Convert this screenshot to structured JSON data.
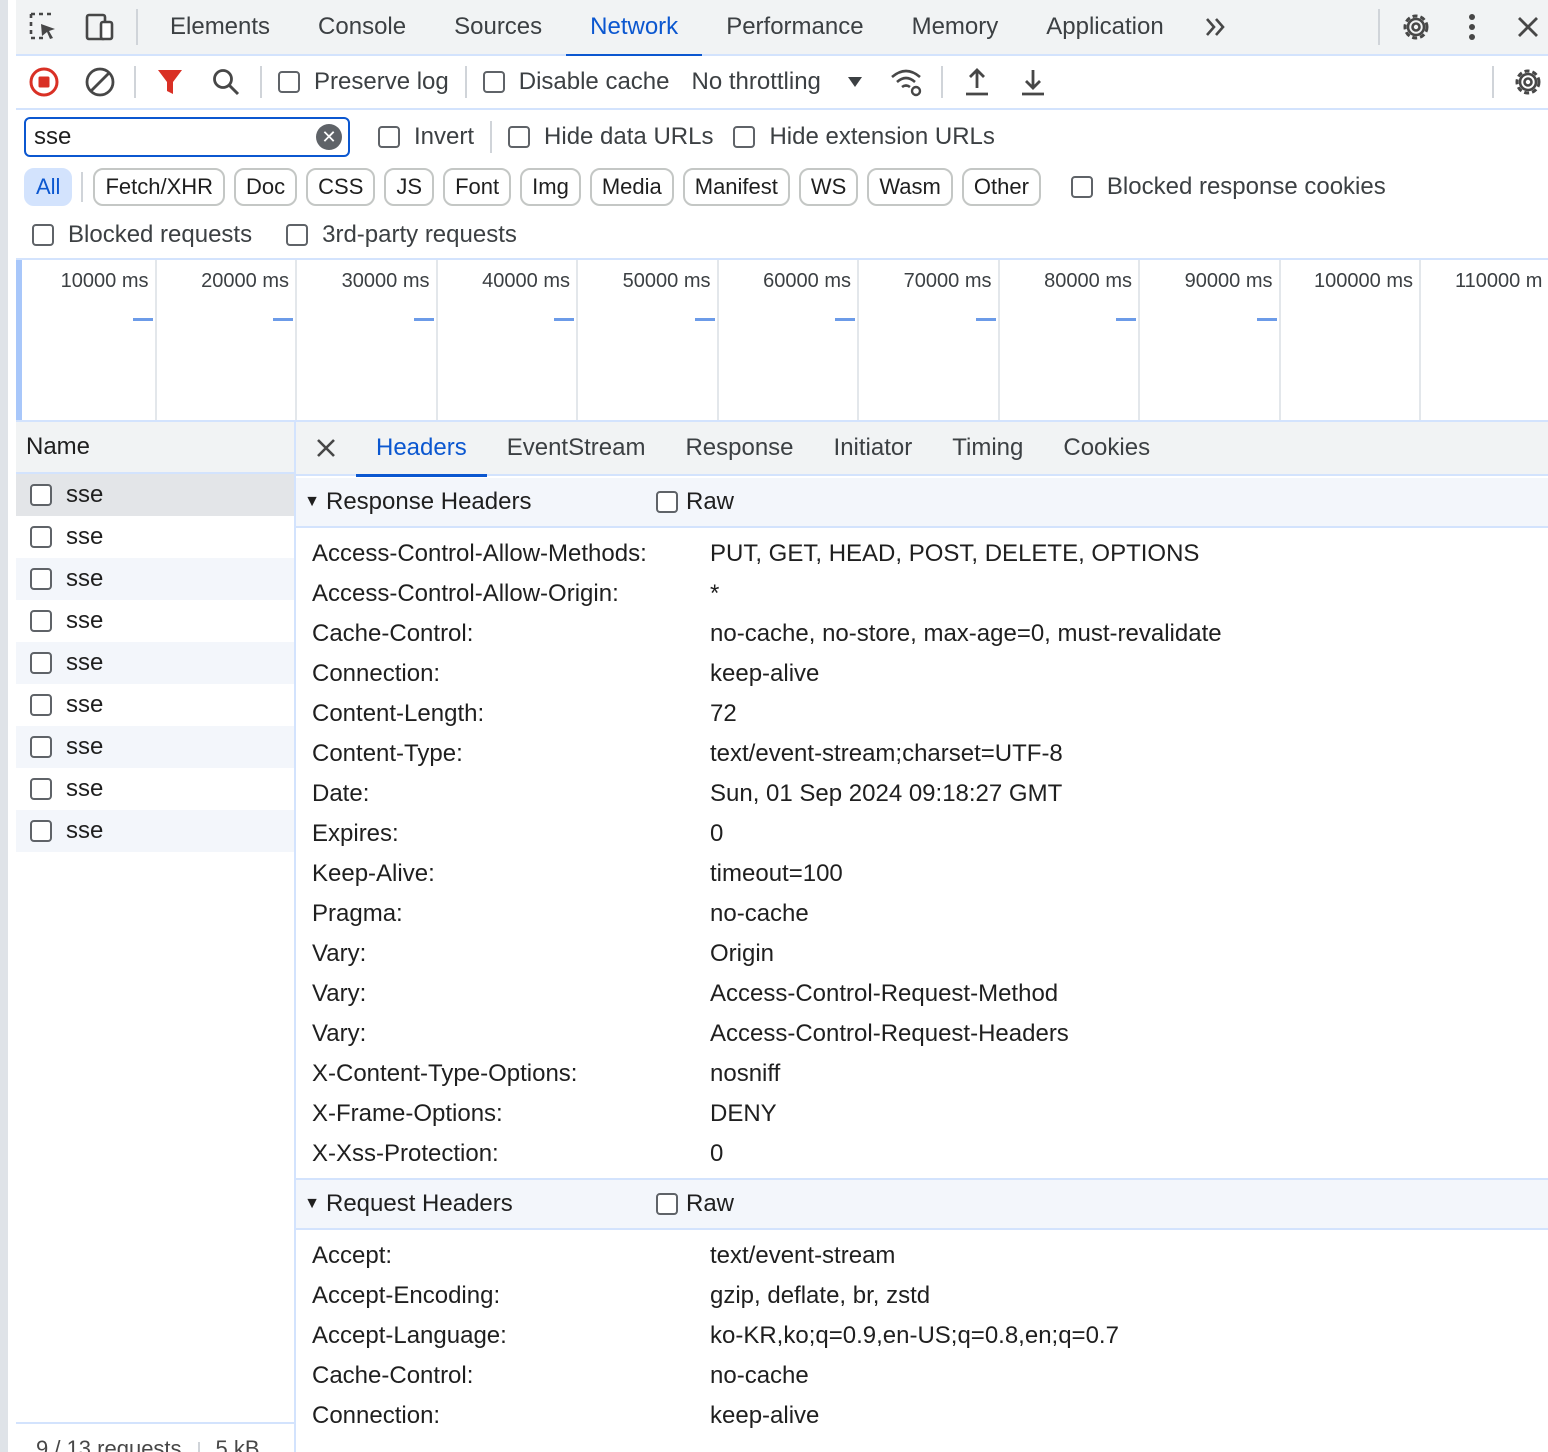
{
  "tabs": [
    "Elements",
    "Console",
    "Sources",
    "Network",
    "Performance",
    "Memory",
    "Application"
  ],
  "active_tab": "Network",
  "toolbar": {
    "preserve_log": "Preserve log",
    "disable_cache": "Disable cache",
    "throttling": "No throttling"
  },
  "filter": {
    "search_value": "sse",
    "invert": "Invert",
    "hide_data_urls": "Hide data URLs",
    "hide_extension_urls": "Hide extension URLs",
    "types": [
      "All",
      "Fetch/XHR",
      "Doc",
      "CSS",
      "JS",
      "Font",
      "Img",
      "Media",
      "Manifest",
      "WS",
      "Wasm",
      "Other"
    ],
    "blocked_response_cookies": "Blocked response cookies",
    "blocked_requests": "Blocked requests",
    "third_party": "3rd-party requests"
  },
  "overview": {
    "ticks": [
      "10000 ms",
      "20000 ms",
      "30000 ms",
      "40000 ms",
      "50000 ms",
      "60000 ms",
      "70000 ms",
      "80000 ms",
      "90000 ms",
      "100000 ms",
      "110000 m"
    ]
  },
  "list": {
    "header": "Name",
    "rows": [
      "sse",
      "sse",
      "sse",
      "sse",
      "sse",
      "sse",
      "sse",
      "sse",
      "sse"
    ],
    "footer_requests": "9 / 13 requests",
    "footer_size": "5 kB"
  },
  "details": {
    "tabs": [
      "Headers",
      "EventStream",
      "Response",
      "Initiator",
      "Timing",
      "Cookies"
    ],
    "active": "Headers",
    "raw_label": "Raw",
    "response_title": "Response Headers",
    "response_headers": [
      {
        "k": "Access-Control-Allow-Methods:",
        "v": "PUT, GET, HEAD, POST, DELETE, OPTIONS"
      },
      {
        "k": "Access-Control-Allow-Origin:",
        "v": "*"
      },
      {
        "k": "Cache-Control:",
        "v": "no-cache, no-store, max-age=0, must-revalidate"
      },
      {
        "k": "Connection:",
        "v": "keep-alive"
      },
      {
        "k": "Content-Length:",
        "v": "72"
      },
      {
        "k": "Content-Type:",
        "v": "text/event-stream;charset=UTF-8"
      },
      {
        "k": "Date:",
        "v": "Sun, 01 Sep 2024 09:18:27 GMT"
      },
      {
        "k": "Expires:",
        "v": "0"
      },
      {
        "k": "Keep-Alive:",
        "v": "timeout=100"
      },
      {
        "k": "Pragma:",
        "v": "no-cache"
      },
      {
        "k": "Vary:",
        "v": "Origin"
      },
      {
        "k": "Vary:",
        "v": "Access-Control-Request-Method"
      },
      {
        "k": "Vary:",
        "v": "Access-Control-Request-Headers"
      },
      {
        "k": "X-Content-Type-Options:",
        "v": "nosniff"
      },
      {
        "k": "X-Frame-Options:",
        "v": "DENY"
      },
      {
        "k": "X-Xss-Protection:",
        "v": "0"
      }
    ],
    "request_title": "Request Headers",
    "request_headers": [
      {
        "k": "Accept:",
        "v": "text/event-stream"
      },
      {
        "k": "Accept-Encoding:",
        "v": "gzip, deflate, br, zstd"
      },
      {
        "k": "Accept-Language:",
        "v": "ko-KR,ko;q=0.9,en-US;q=0.8,en;q=0.7"
      },
      {
        "k": "Cache-Control:",
        "v": "no-cache"
      },
      {
        "k": "Connection:",
        "v": "keep-alive"
      }
    ]
  },
  "colors": {
    "accent": "#0b57d0",
    "record_red": "#d93025",
    "filter_red": "#d93025"
  }
}
